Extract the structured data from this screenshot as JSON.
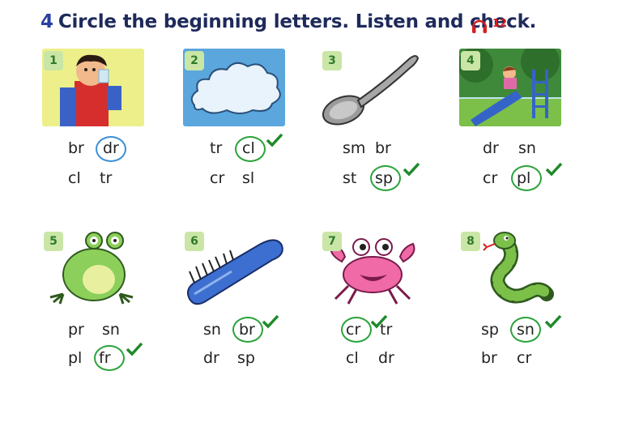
{
  "header": {
    "number": "4",
    "instruction": "Circle the beginning letters. Listen and check.",
    "track": "12",
    "audio_icon": "headphones-icon",
    "accent": "#1e2a5a",
    "track_color": "#d32020"
  },
  "items": [
    {
      "n": "1",
      "picture": "boy drinking",
      "words": [
        "br",
        "dr",
        "cl",
        "tr"
      ],
      "circled": "dr",
      "circle_color": "blue",
      "checked": false
    },
    {
      "n": "2",
      "picture": "cloud",
      "words": [
        "tr",
        "cl",
        "cr",
        "sl"
      ],
      "circled": "cl",
      "circle_color": "green",
      "checked": true
    },
    {
      "n": "3",
      "picture": "spoon",
      "words": [
        "sm",
        "br",
        "st",
        "sp"
      ],
      "circled": "sp",
      "circle_color": "green",
      "checked": true
    },
    {
      "n": "4",
      "picture": "girl on slide",
      "words": [
        "dr",
        "sn",
        "cr",
        "pl"
      ],
      "circled": "pl",
      "circle_color": "green",
      "checked": true
    },
    {
      "n": "5",
      "picture": "frog",
      "words": [
        "pr",
        "sn",
        "pl",
        "fr"
      ],
      "circled": "fr",
      "circle_color": "green",
      "checked": true
    },
    {
      "n": "6",
      "picture": "brush",
      "words": [
        "sn",
        "br",
        "dr",
        "sp"
      ],
      "circled": "br",
      "circle_color": "green",
      "checked": true
    },
    {
      "n": "7",
      "picture": "crab",
      "words": [
        "cr",
        "tr",
        "cl",
        "dr"
      ],
      "circled": "cr",
      "circle_color": "green",
      "checked": true
    },
    {
      "n": "8",
      "picture": "snake",
      "words": [
        "sp",
        "sn",
        "br",
        "cr"
      ],
      "circled": "sn",
      "circle_color": "green",
      "checked": true
    }
  ]
}
